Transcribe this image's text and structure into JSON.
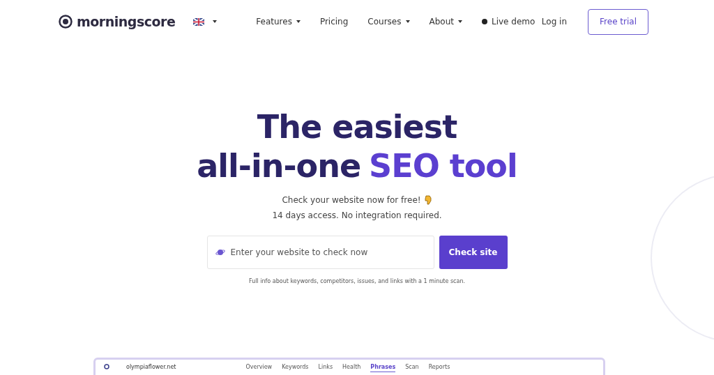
{
  "brand": {
    "name": "morningscore"
  },
  "nav": [
    {
      "label": "Features",
      "dropdown": true,
      "dot": false
    },
    {
      "label": "Pricing",
      "dropdown": false,
      "dot": false
    },
    {
      "label": "Courses",
      "dropdown": true,
      "dot": false
    },
    {
      "label": "About",
      "dropdown": true,
      "dot": false
    },
    {
      "label": "Live demo",
      "dropdown": false,
      "dot": true
    }
  ],
  "login": "Log in",
  "cta": "Free trial",
  "headline": [
    [
      {
        "text": "The easiest",
        "accent": false
      }
    ],
    [
      {
        "text": "all-in-one",
        "accent": false
      },
      {
        "text": "SEO tool",
        "accent": true
      }
    ]
  ],
  "sublines": [
    "Check your website now for free!",
    "14 days access. No integration required."
  ],
  "search": {
    "placeholder": "Enter your website to check now",
    "button": "Check site"
  },
  "note": "Full info about keywords, competitors, issues, and links with a 1 minute scan.",
  "preview": {
    "domain": "olympiaflower.net",
    "tabs": [
      {
        "label": "Overview",
        "selected": false
      },
      {
        "label": "Keywords",
        "selected": false
      },
      {
        "label": "Links",
        "selected": false
      },
      {
        "label": "Health",
        "selected": false
      },
      {
        "label": "Phrases",
        "selected": true
      },
      {
        "label": "Scan",
        "selected": false
      },
      {
        "label": "Reports",
        "selected": false
      }
    ]
  }
}
